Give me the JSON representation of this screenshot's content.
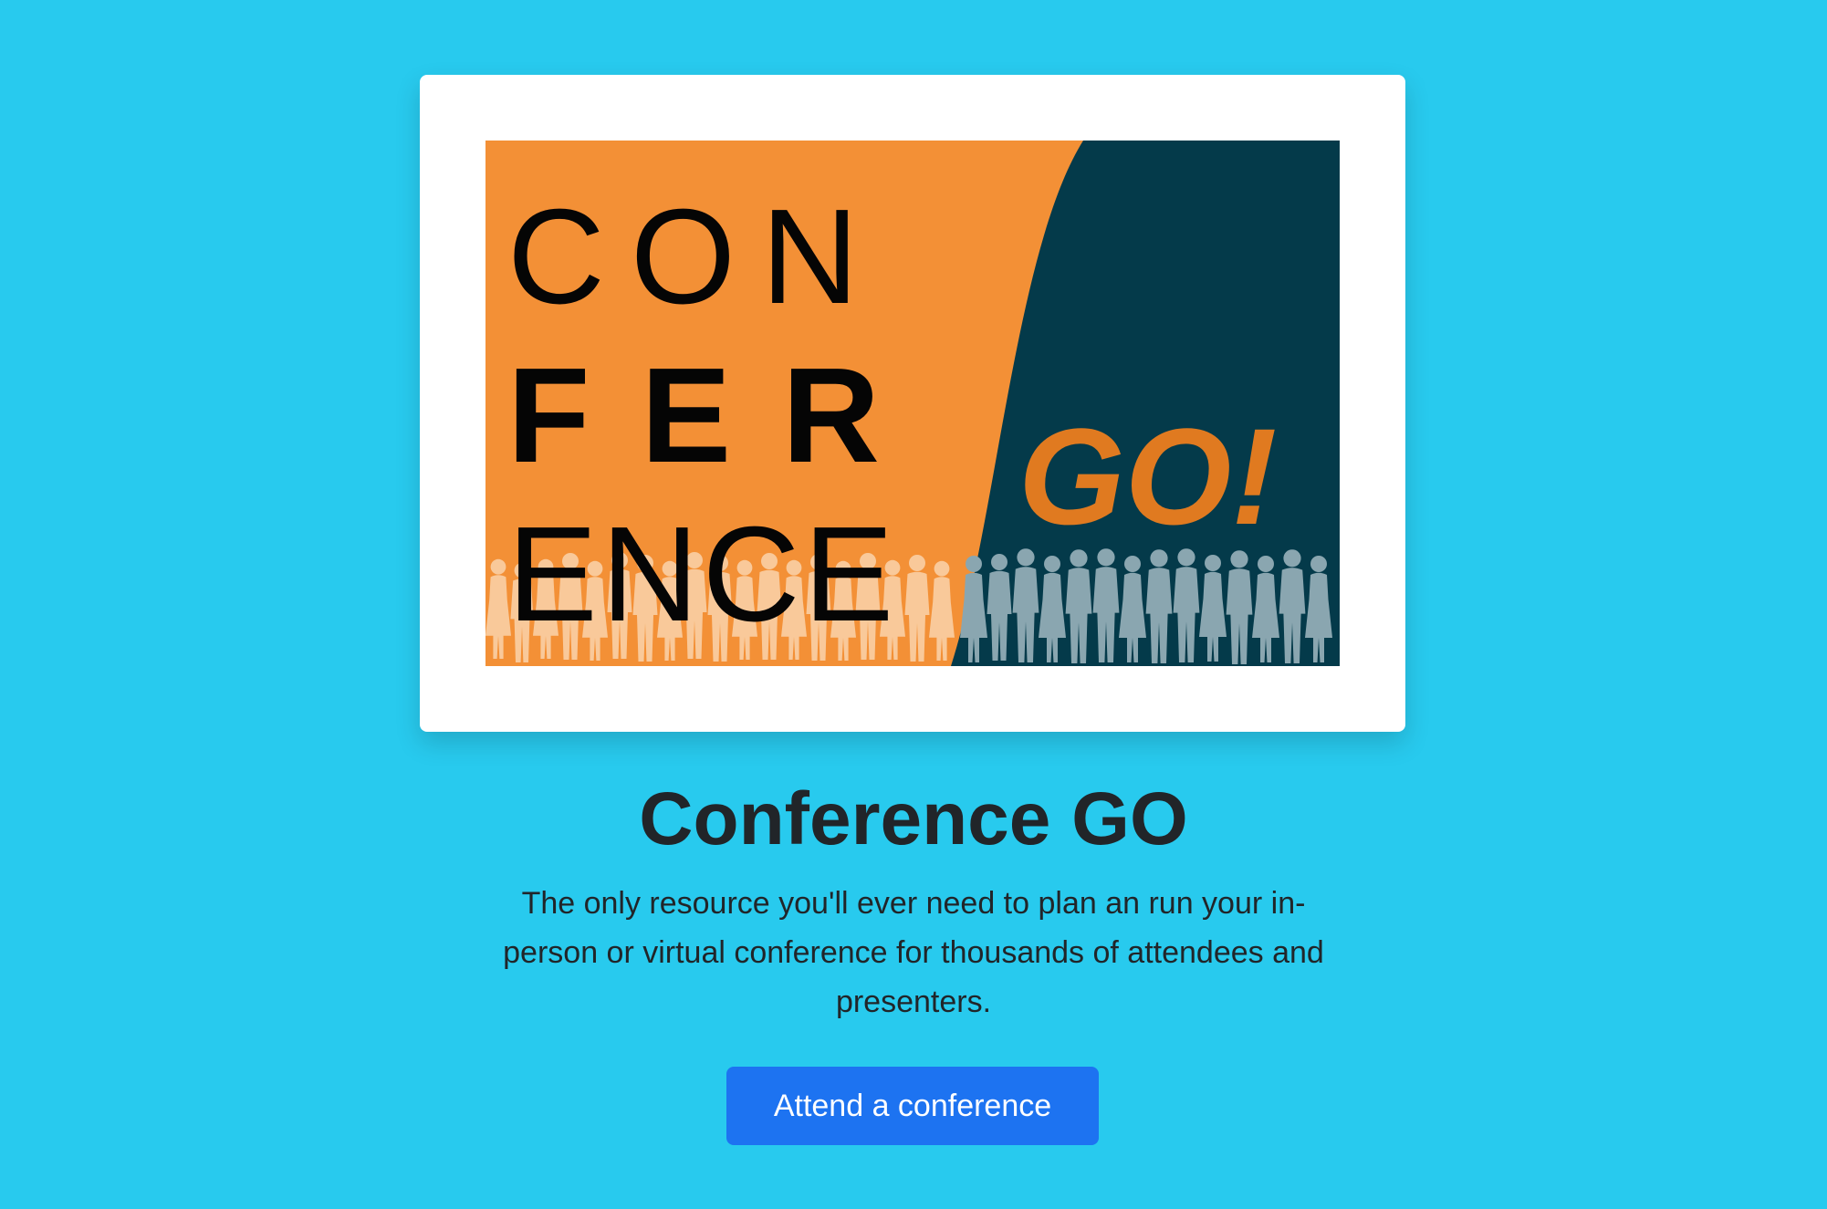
{
  "logo": {
    "line1": "CON",
    "line2": "FER",
    "line3": "ENCE",
    "go_text": "GO!",
    "colors": {
      "orange": "#f39036",
      "navy": "#043a4a",
      "go": "#e07a20"
    }
  },
  "hero": {
    "title": "Conference GO",
    "description": "The only resource you'll ever need to plan an run your in-person or virtual conference for thousands of attendees and presenters.",
    "button_label": "Attend a conference"
  },
  "colors": {
    "background": "#28caee",
    "button": "#1d73f1",
    "text": "#212529"
  }
}
